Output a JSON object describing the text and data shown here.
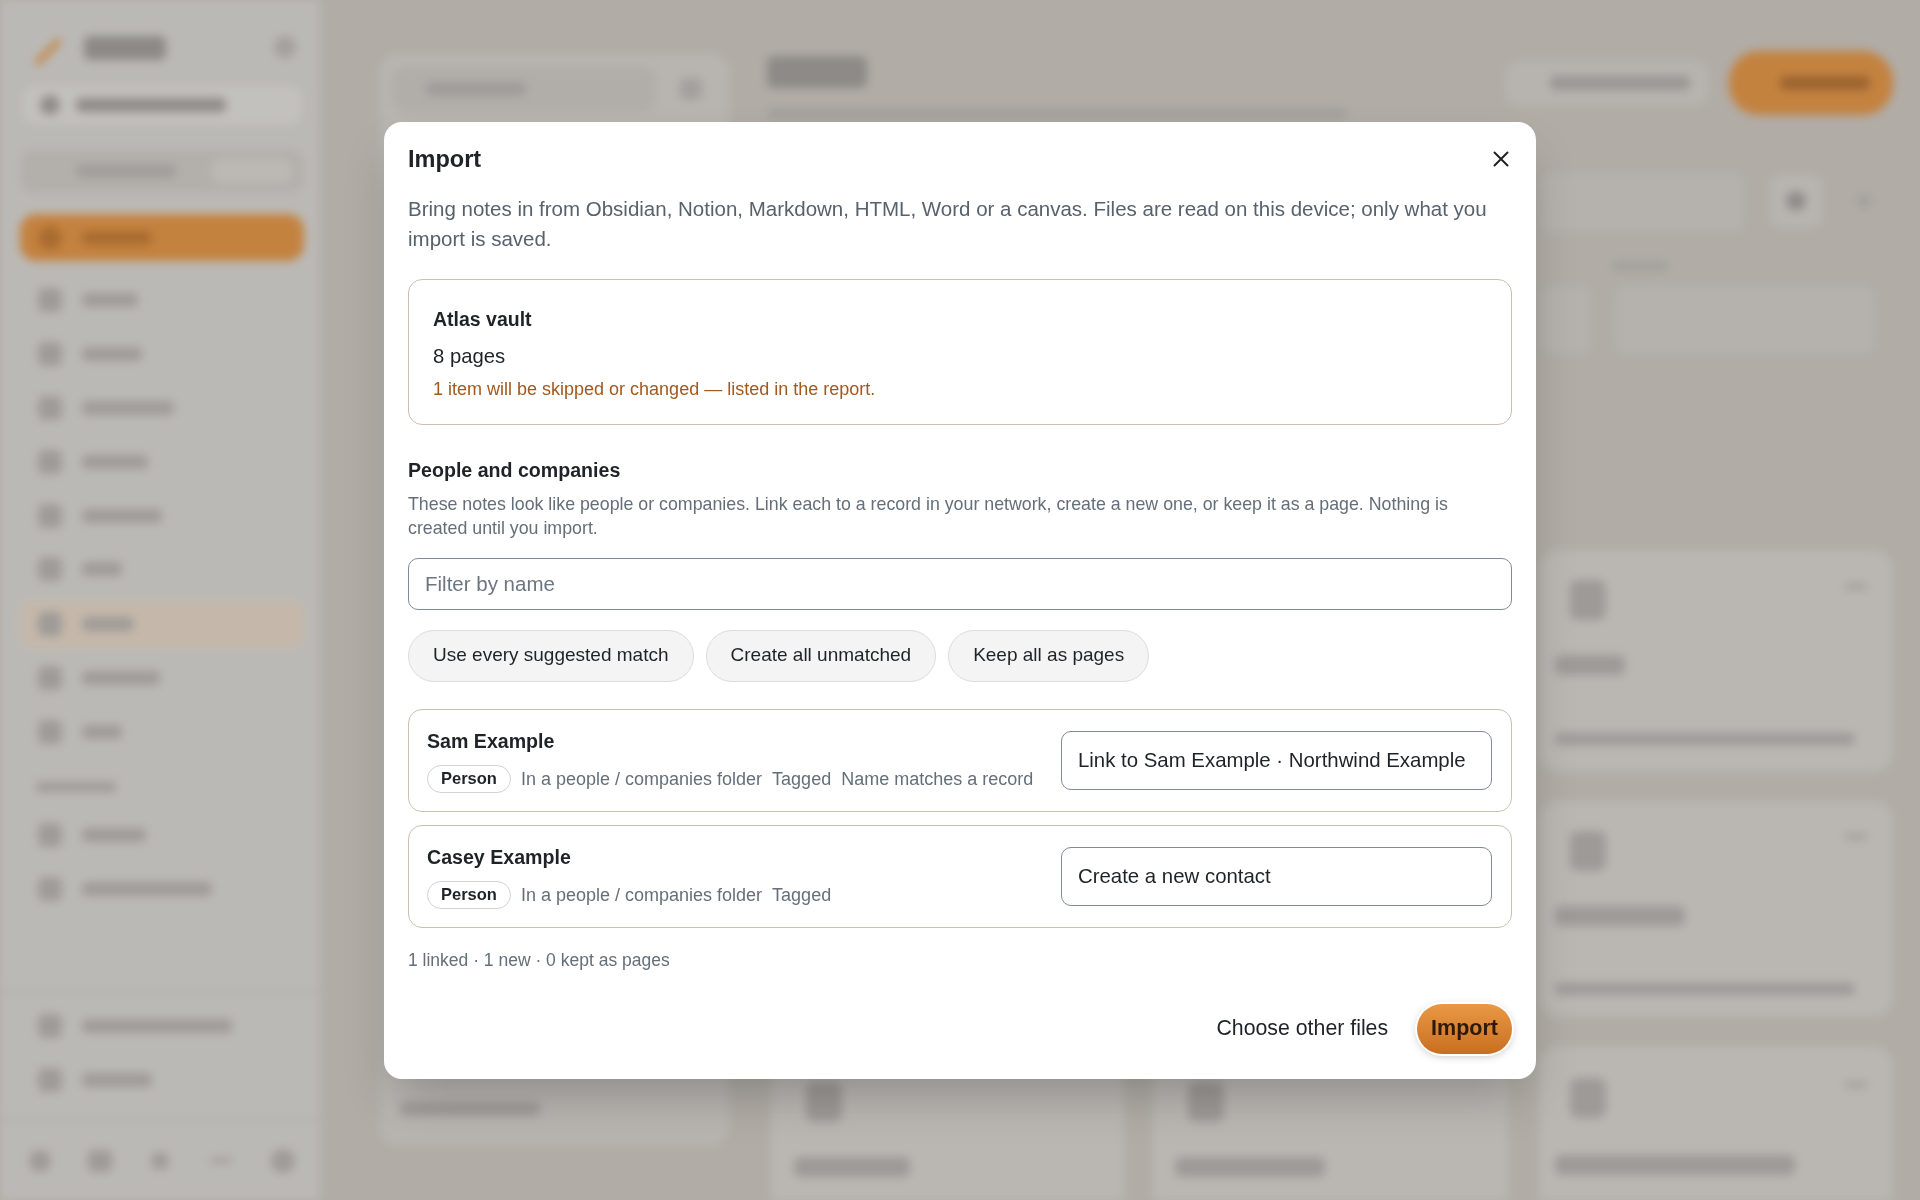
{
  "dialog": {
    "title": "Import",
    "description": "Bring notes in from Obsidian, Notion, Markdown, HTML, Word or a canvas. Files are read on this device; only what you import is saved.",
    "source": {
      "name": "Atlas vault",
      "count": "8 pages",
      "warning": "1 item will be skipped or changed — listed in the report."
    },
    "people_section": {
      "heading": "People and companies",
      "description": "These notes look like people or companies. Link each to a record in your network, create a new one, or keep it as a page. Nothing is created until you import.",
      "filter": {
        "placeholder": "Filter by name"
      },
      "bulk_actions": [
        "Use every suggested match",
        "Create all unmatched",
        "Keep all as pages"
      ],
      "items": [
        {
          "name": "Sam Example",
          "badge": "Person",
          "reasons": [
            "In a people / companies folder",
            "Tagged",
            "Name matches a record"
          ],
          "choice": "Link to Sam Example · Northwind Example"
        },
        {
          "name": "Casey Example",
          "badge": "Person",
          "reasons": [
            "In a people / companies folder",
            "Tagged"
          ],
          "choice": "Create a new contact"
        }
      ],
      "summary": "1 linked · 1 new · 0 kept as pages"
    },
    "footer": {
      "secondary_button": "Choose other files",
      "primary_button": "Import"
    }
  }
}
